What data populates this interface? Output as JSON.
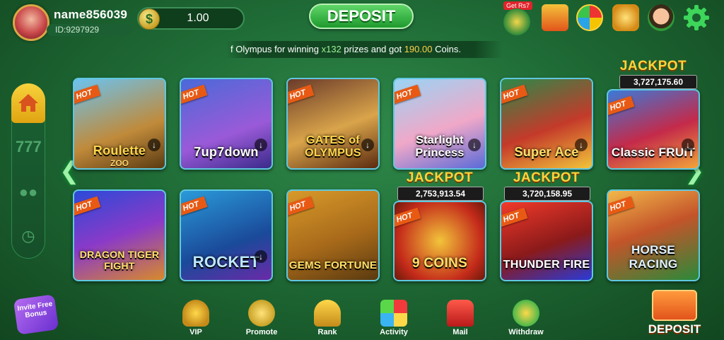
{
  "user": {
    "name": "name856039",
    "id": "ID:9297929"
  },
  "balance": {
    "currency_symbol": "$",
    "value": "1.00"
  },
  "header": {
    "deposit_label": "DEPOSIT",
    "get_rs_badge": "Get Rs7"
  },
  "marquee": {
    "part1": "f Olympus for winning ",
    "multiplier": "x132",
    "part2": " prizes and got ",
    "amount": "190.00",
    "part3": " Coins."
  },
  "games_row1": [
    {
      "title": "Roulette",
      "subtitle": "ZOO",
      "hot": "HOT"
    },
    {
      "title": "7up7down",
      "subtitle": "",
      "hot": "HOT"
    },
    {
      "title": "GATES of OLYMPUS",
      "subtitle": "",
      "hot": "HOT"
    },
    {
      "title": "Starlight Princess",
      "subtitle": "",
      "hot": "HOT"
    },
    {
      "title": "Super Ace",
      "subtitle": "",
      "hot": "HOT"
    },
    {
      "title": "Classic FRUIT",
      "subtitle": "",
      "hot": "HOT",
      "jackpot_label": "JACKPOT",
      "jackpot_value": "3,727,175.60"
    }
  ],
  "games_row2": [
    {
      "title": "DRAGON TIGER FIGHT",
      "subtitle": "",
      "hot": "HOT"
    },
    {
      "title": "ROCKET",
      "subtitle": "",
      "hot": "HOT"
    },
    {
      "title": "GEMS FORTUNE",
      "subtitle": "",
      "hot": "HOT"
    },
    {
      "title": "9 COINS",
      "subtitle": "",
      "hot": "HOT",
      "jackpot_label": "JACKPOT",
      "jackpot_value": "2,753,913.54"
    },
    {
      "title": "THUNDER FIRE",
      "subtitle": "",
      "hot": "HOT",
      "jackpot_label": "JACKPOT",
      "jackpot_value": "3,720,158.95"
    },
    {
      "title": "HORSE RACING",
      "subtitle": "",
      "hot": "HOT"
    }
  ],
  "bottom_nav": [
    {
      "label": "VIP"
    },
    {
      "label": "Promote"
    },
    {
      "label": "Rank"
    },
    {
      "label": "Activity"
    },
    {
      "label": "Mail"
    },
    {
      "label": "Withdraw"
    }
  ],
  "invite": {
    "label": "Invite Free Bonus"
  },
  "bottom_deposit": {
    "label": "DEPOSIT"
  },
  "colors": {
    "accent_green": "#1f9a2e",
    "gold": "#ffd43b",
    "hot_orange": "#e85a14",
    "card_border": "#5fc8e0"
  }
}
